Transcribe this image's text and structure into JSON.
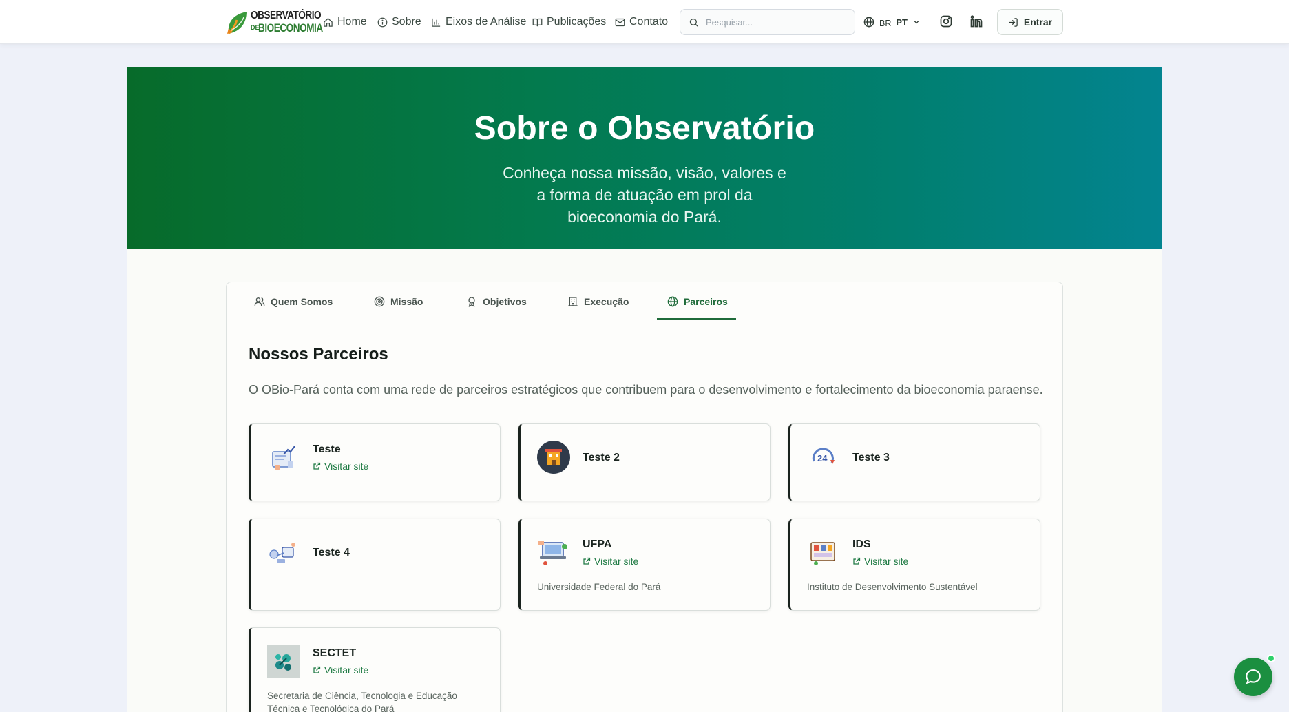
{
  "brand": {
    "line1": "OBSERVATÓRIO",
    "de": "DE",
    "line2": "BIOECONOMIA"
  },
  "nav": {
    "items": [
      {
        "label": "Home",
        "icon": "home-icon"
      },
      {
        "label": "Sobre",
        "icon": "info-icon"
      },
      {
        "label": "Eixos de Análise",
        "icon": "bar-chart-icon"
      },
      {
        "label": "Publicações",
        "icon": "book-icon"
      },
      {
        "label": "Contato",
        "icon": "mail-icon"
      }
    ]
  },
  "search": {
    "placeholder": "Pesquisar..."
  },
  "language": {
    "flag": "BR",
    "code": "PT"
  },
  "social": {
    "instagram": "instagram-icon",
    "linkedin": "linkedin-icon"
  },
  "login": {
    "label": "Entrar"
  },
  "hero": {
    "title": "Sobre o Observatório",
    "subtitle": "Conheça nossa missão, visão, valores e a forma de atuação em prol da bioeconomia do Pará."
  },
  "tabs": [
    {
      "label": "Quem Somos",
      "icon": "users-icon"
    },
    {
      "label": "Missão",
      "icon": "target-icon"
    },
    {
      "label": "Objetivos",
      "icon": "award-icon"
    },
    {
      "label": "Execução",
      "icon": "building-icon"
    },
    {
      "label": "Parceiros",
      "icon": "globe-icon",
      "active": true
    }
  ],
  "partners_section": {
    "title": "Nossos Parceiros",
    "description": "O OBio-Pará conta com uma rede de parceiros estratégicos que contribuem para o desenvolvimento e fortalecimento da bioeconomia paraense."
  },
  "visit_label": "Visitar site",
  "partners": [
    {
      "name": "Teste",
      "visit": "Visitar site",
      "description": ""
    },
    {
      "name": "Teste 2",
      "visit": "",
      "description": ""
    },
    {
      "name": "Teste 3",
      "visit": "",
      "description": ""
    },
    {
      "name": "Teste 4",
      "visit": "",
      "description": ""
    },
    {
      "name": "UFPA",
      "visit": "Visitar site",
      "description": "Universidade Federal do Pará"
    },
    {
      "name": "IDS",
      "visit": "Visitar site",
      "description": "Instituto de Desenvolvimento Sustentável"
    },
    {
      "name": "SECTET",
      "visit": "Visitar site",
      "description": "Secretaria de Ciência, Tecnologia e Educação Técnica e Tecnológica do Pará"
    }
  ],
  "colors": {
    "accent": "#1f6b3a",
    "hero_start": "#076b2a",
    "hero_end": "#038490",
    "chat": "#1b8f40"
  }
}
